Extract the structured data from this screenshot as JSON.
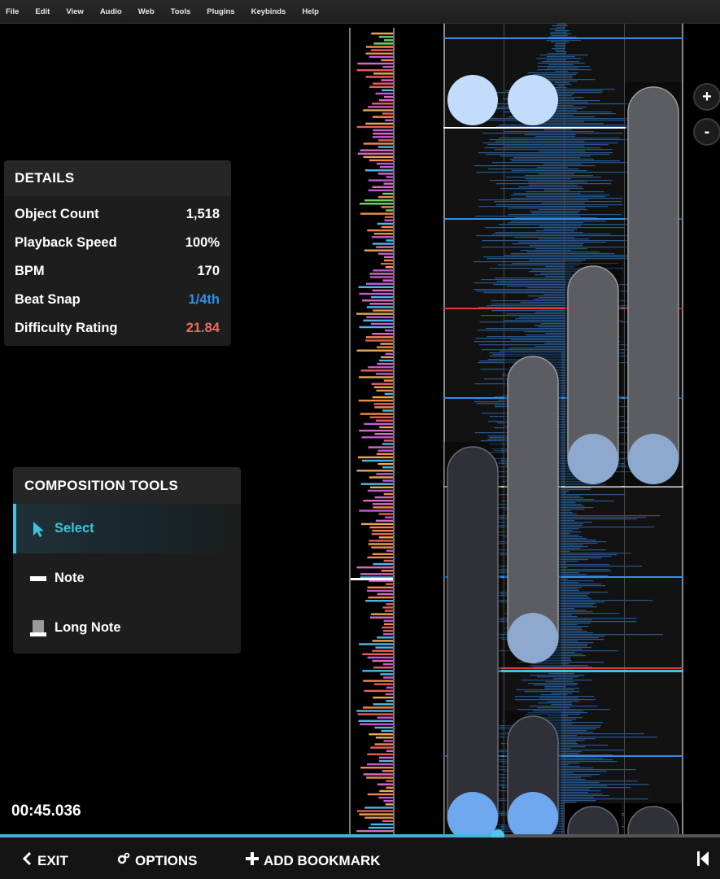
{
  "menu": [
    "File",
    "Edit",
    "View",
    "Audio",
    "Web",
    "Tools",
    "Plugins",
    "Keybinds",
    "Help"
  ],
  "details": {
    "title": "DETAILS",
    "rows": [
      {
        "label": "Object Count",
        "value": "1,518",
        "color": "#ffffff"
      },
      {
        "label": "Playback Speed",
        "value": "100%",
        "color": "#ffffff"
      },
      {
        "label": "BPM",
        "value": "170",
        "color": "#ffffff"
      },
      {
        "label": "Beat Snap",
        "value": "1/4th",
        "color": "#2f8fe8"
      },
      {
        "label": "Difficulty Rating",
        "value": "21.84",
        "color": "#f26a5e"
      }
    ]
  },
  "tools": {
    "title": "COMPOSITION TOOLS",
    "items": [
      {
        "label": "Select",
        "icon": "cursor-arrow-icon",
        "active": true
      },
      {
        "label": "Note",
        "icon": "note-bar-icon",
        "active": false
      },
      {
        "label": "Long Note",
        "icon": "long-note-icon",
        "active": false
      }
    ]
  },
  "playback": {
    "time": "00:45.036",
    "progress": 0.692
  },
  "zoom": {
    "in": "+",
    "out": "-"
  },
  "bottom": {
    "exit": "EXIT",
    "options": "OPTIONS",
    "bookmark": "ADD BOOKMARK"
  },
  "colors": {
    "accent": "#3fc3e0",
    "beat_snap": "#2f8fe8",
    "difficulty": "#f26a5e",
    "waveform": "#2d6fb6",
    "measure_line": "#2f8fe8",
    "timing_point": "#e23a3a"
  }
}
